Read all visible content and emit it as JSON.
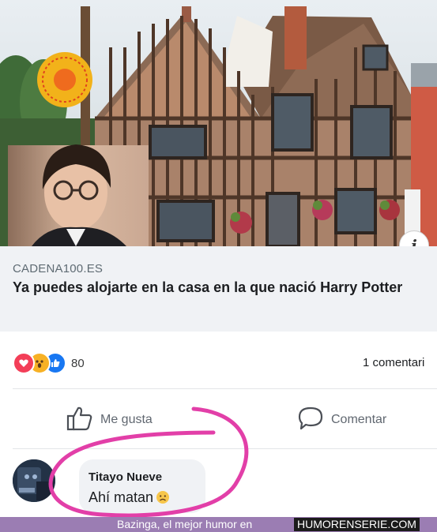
{
  "link_preview": {
    "domain": "CADENA100.ES",
    "title": "Ya puedes alojarte en la casa en la que nació Harry Potter",
    "image_icon": "house-photo",
    "info_icon": "info-icon",
    "info_glyph": "i"
  },
  "reactions": {
    "icons": [
      "love-reaction-icon",
      "wow-reaction-icon",
      "like-reaction-icon"
    ],
    "count": "80",
    "comments_count": "1 comentari"
  },
  "actions": {
    "like_label": "Me gusta",
    "comment_label": "Comentar"
  },
  "comment": {
    "author": "Titayo Nueve",
    "text": "Ahí matan",
    "emoji_icon": "sad-face-icon"
  },
  "footer": {
    "text": "Bazinga, el mejor humor en",
    "site": "HUMORENSERIE.COM"
  },
  "colors": {
    "facebook_blue": "#1877f2",
    "love_red": "#f33e58",
    "wow_yellow": "#f7b125",
    "annotation_pink": "#e23fa8",
    "caption_bg": "#f0f2f5",
    "footer_bg": "#9b7db3"
  }
}
